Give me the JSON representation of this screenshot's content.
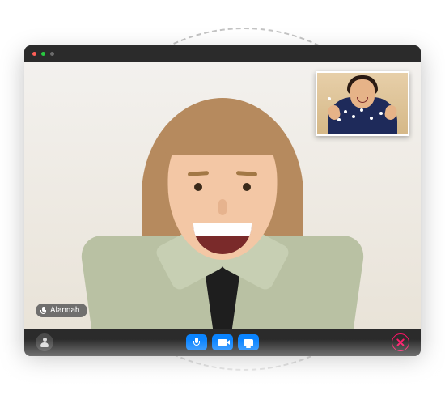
{
  "participant": {
    "name": "Alannah",
    "mic_icon": "mic-icon"
  },
  "self_view": {
    "label": "self-view"
  },
  "controls": {
    "participants_icon": "person-icon",
    "mic_button": "mic-icon",
    "camera_button": "camera-icon",
    "share_button": "screen-share-icon",
    "end_call_button": "close-icon"
  },
  "window": {
    "traffic_lights": [
      "red",
      "green",
      "grey"
    ]
  },
  "colors": {
    "accent": "#0a84ff",
    "danger": "#ff1466",
    "bar": "#2b2b2b"
  }
}
